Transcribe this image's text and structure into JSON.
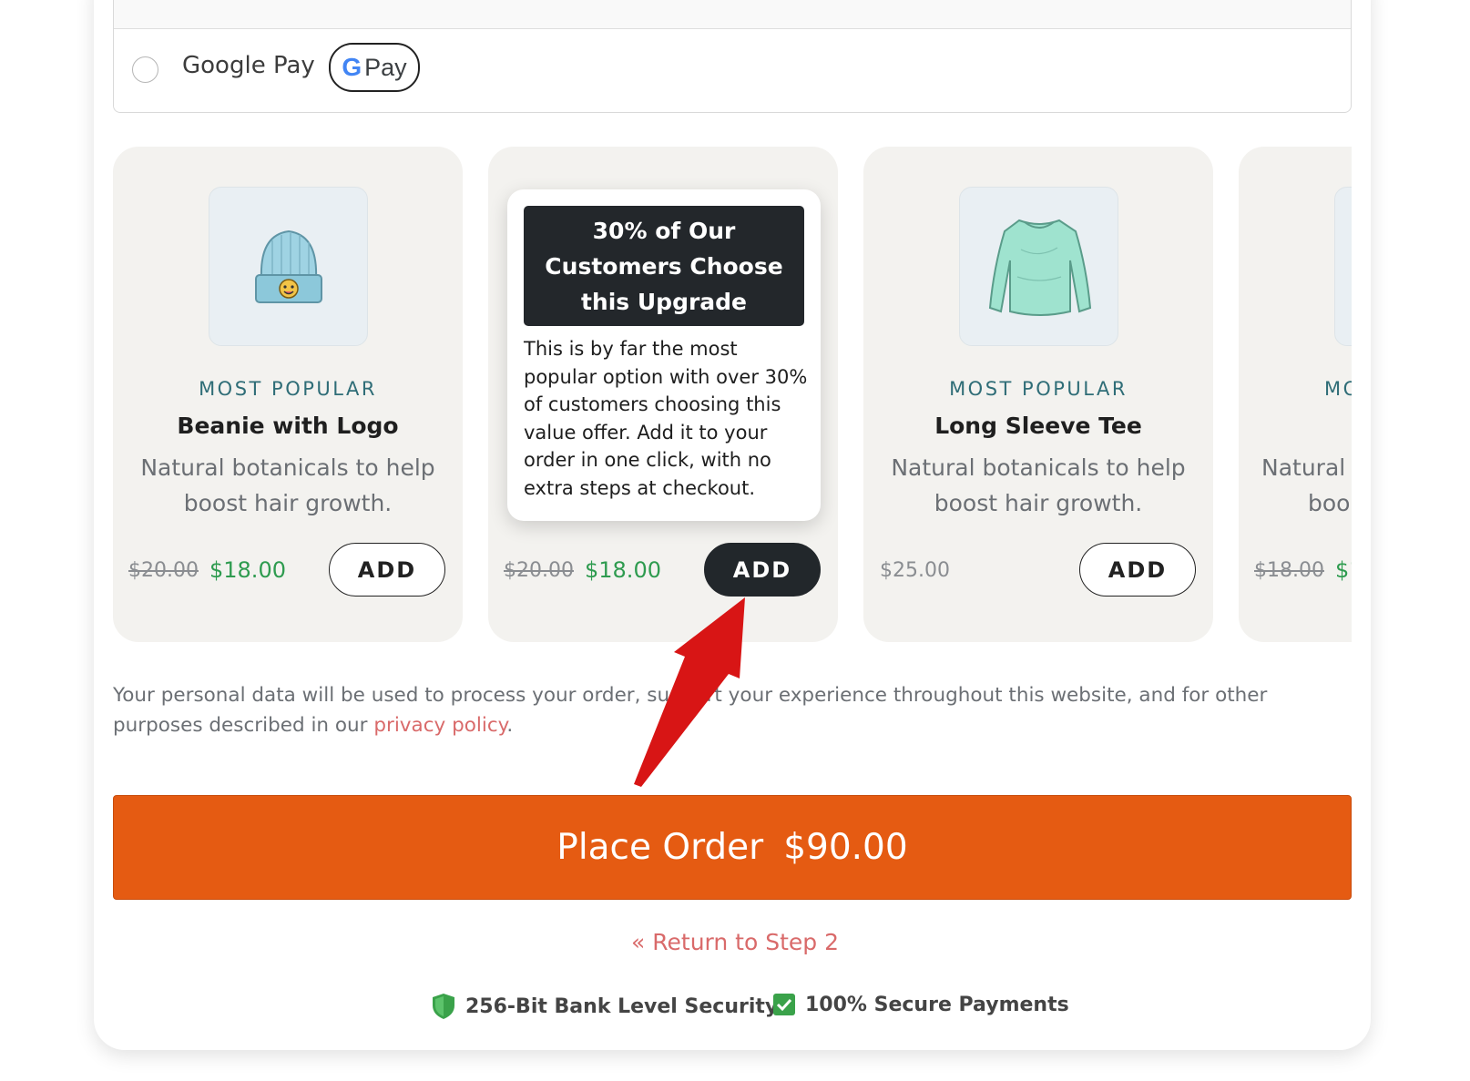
{
  "payment": {
    "google_pay_label": "Google Pay",
    "gpay_badge_g": "G",
    "gpay_badge_pay": "Pay"
  },
  "products": [
    {
      "tag": "MOST POPULAR",
      "name": "Beanie with Logo",
      "desc": "Natural botanicals to help boost hair growth.",
      "old_price": "$20.00",
      "price": "$18.00",
      "add": "ADD",
      "icon": "beanie-icon"
    },
    {
      "old_price": "$20.00",
      "price": "$18.00",
      "add": "ADD"
    },
    {
      "tag": "MOST POPULAR",
      "name": "Long Sleeve Tee",
      "desc": "Natural botanicals to help boost hair growth.",
      "price": "$25.00",
      "add": "ADD",
      "icon": "long-sleeve-tee-icon"
    },
    {
      "tag": "MO",
      "desc_partial": "Natural",
      "desc_partial2": "boo",
      "old_price": "$18.00",
      "price": "$1"
    }
  ],
  "tooltip": {
    "heading": "30% of Our Customers Choose this Upgrade",
    "body": "This is by far the most popular option with over 30% of customers choosing this value offer. Add it to your order in one click, with no extra steps at checkout."
  },
  "privacy": {
    "text": "Your personal data will be used to process your order, support your experience throughout this website, and for other purposes described in our ",
    "link": "privacy policy",
    "end": "."
  },
  "place_order": {
    "label": "Place Order",
    "amount": "$90.00"
  },
  "return_link": "« Return to Step 2",
  "trust": {
    "security": "256-Bit Bank Level Security",
    "payments": "100% Secure Payments"
  },
  "colors": {
    "accent_orange": "#e55b12",
    "sale_green": "#2e9b4f",
    "tag_teal": "#2f6d77",
    "link_red": "#d96a6a",
    "arrow_red": "#d81515"
  }
}
